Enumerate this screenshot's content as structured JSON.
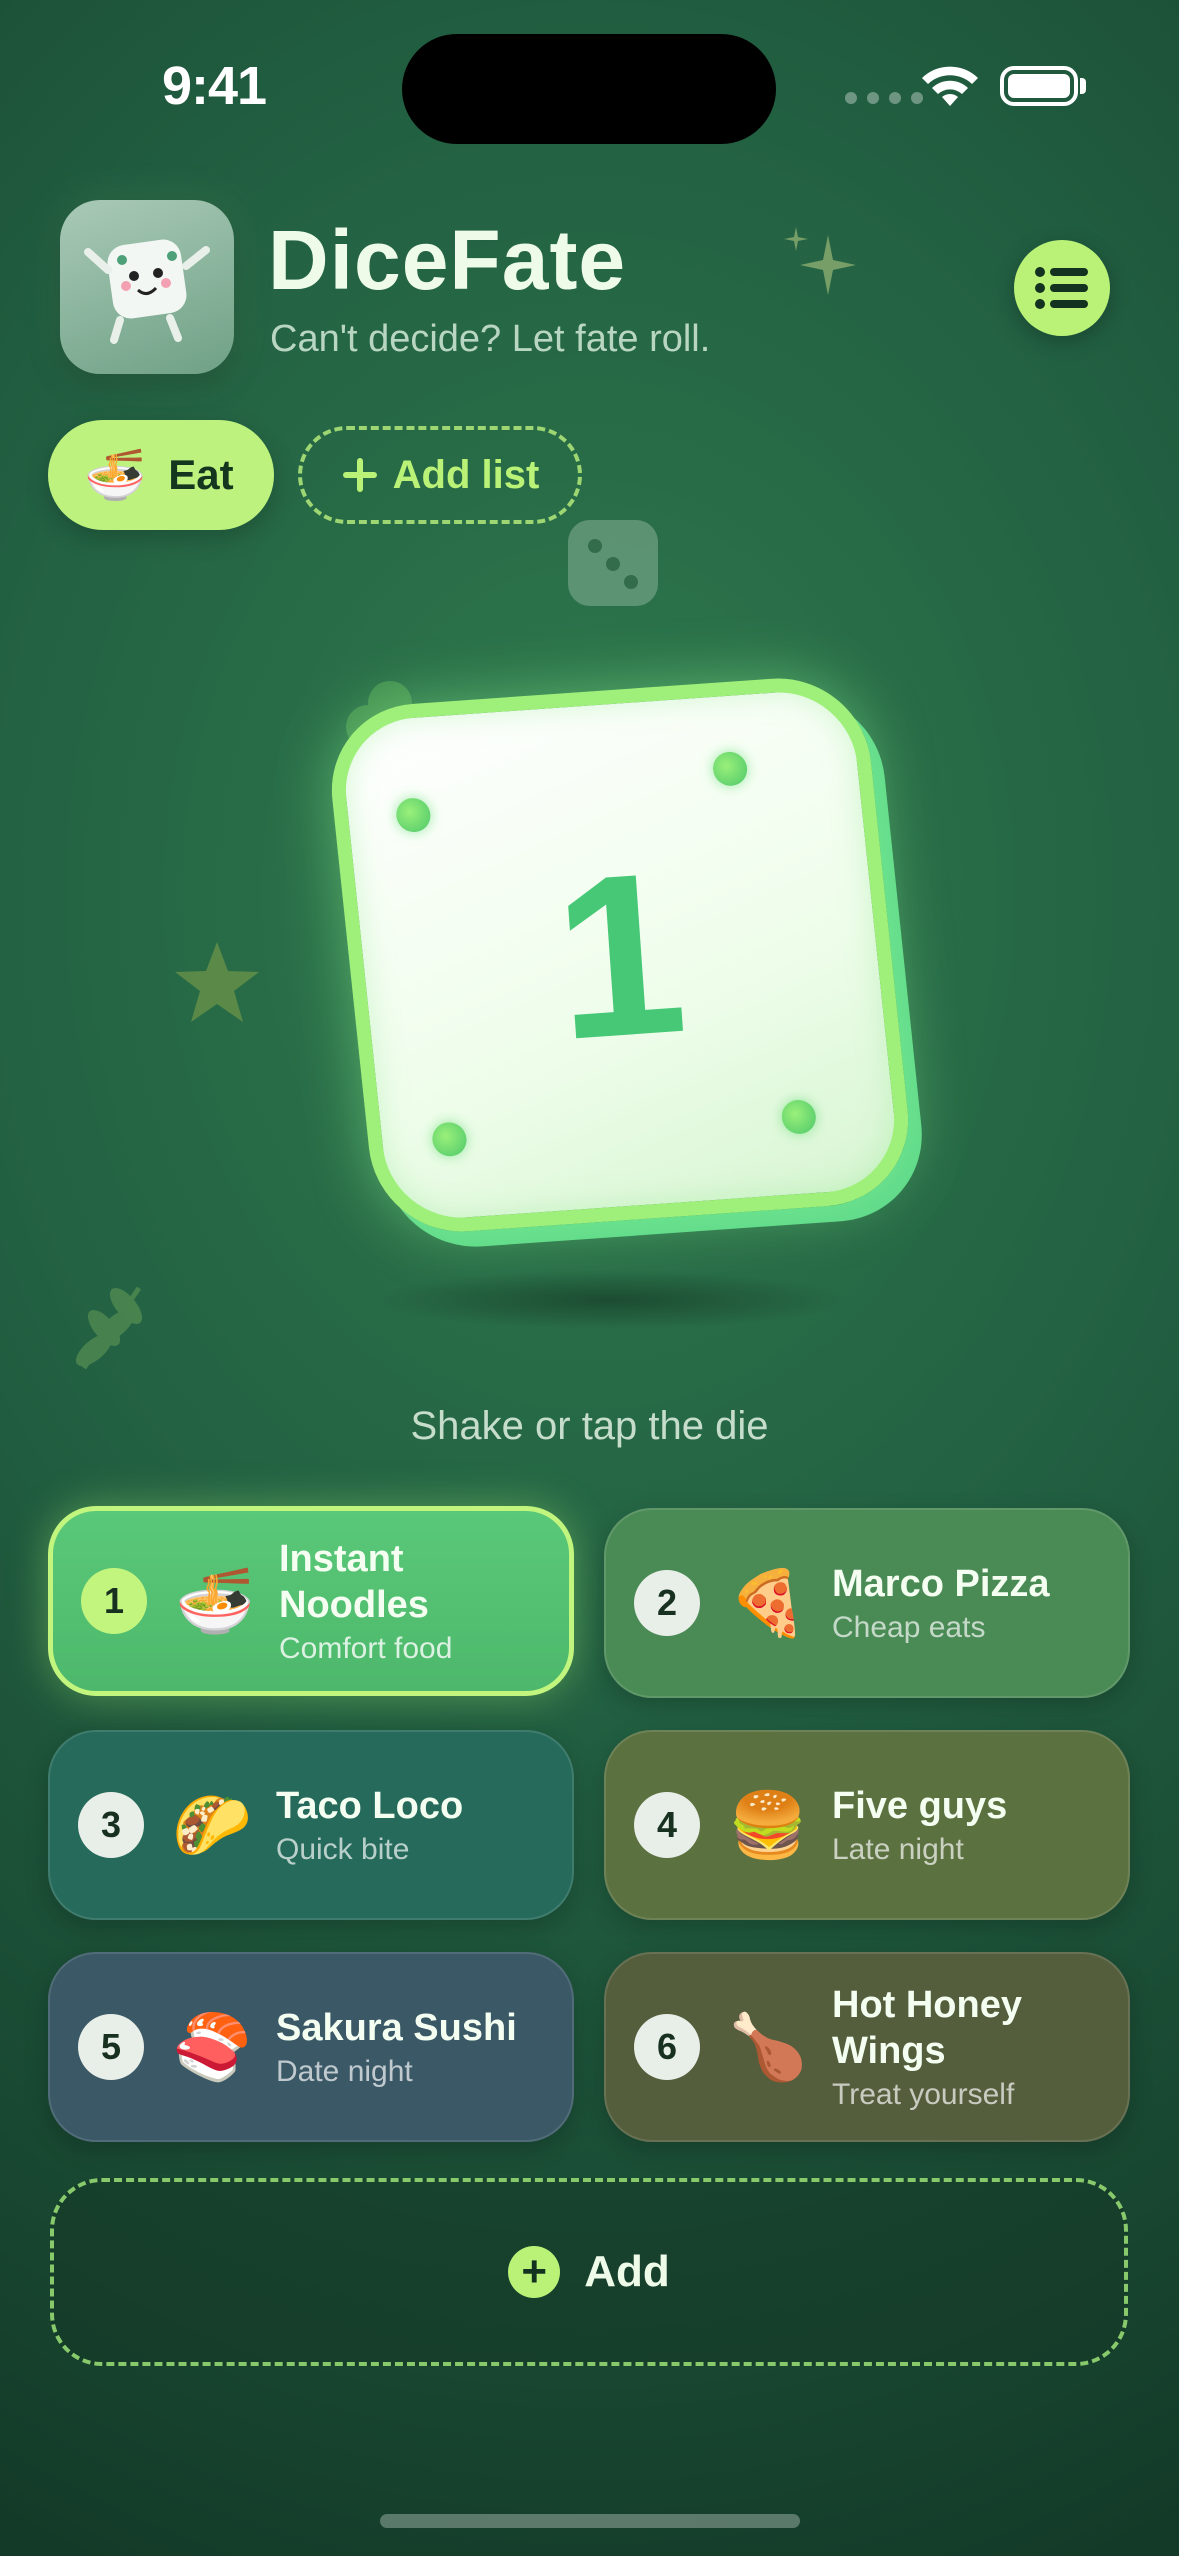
{
  "status_bar": {
    "time": "9:41"
  },
  "header": {
    "app_icon": "dice-mascot-icon",
    "title": "DiceFate",
    "subtitle": "Can't decide? Let fate roll.",
    "menu_icon": "list-icon"
  },
  "lists": [
    {
      "emoji": "🍜",
      "label": "Eat",
      "selected": true
    }
  ],
  "add_list_label": "Add list",
  "die": {
    "value": "1"
  },
  "hint": "Shake or tap the die",
  "options": [
    {
      "num": "1",
      "emoji": "🍜",
      "name": "Instant Noodles",
      "sub": "Comfort food",
      "color": "#56c276",
      "active": true
    },
    {
      "num": "2",
      "emoji": "🍕",
      "name": "Marco Pizza",
      "sub": "Cheap eats",
      "color": "#4a8a55"
    },
    {
      "num": "3",
      "emoji": "🌮",
      "name": "Taco Loco",
      "sub": "Quick bite",
      "color": "#256a5b"
    },
    {
      "num": "4",
      "emoji": "🍔",
      "name": "Five guys",
      "sub": "Late night",
      "color": "#5b7140"
    },
    {
      "num": "5",
      "emoji": "🍣",
      "name": "Sakura Sushi",
      "sub": "Date night",
      "color": "#3a5866"
    },
    {
      "num": "6",
      "emoji": "🍗",
      "name": "Hot Honey Wings",
      "sub": "Treat yourself",
      "color": "#545e3c"
    }
  ],
  "add_button": {
    "label": "Add"
  },
  "colors": {
    "accent": "#b9f277",
    "background": "#226042"
  }
}
